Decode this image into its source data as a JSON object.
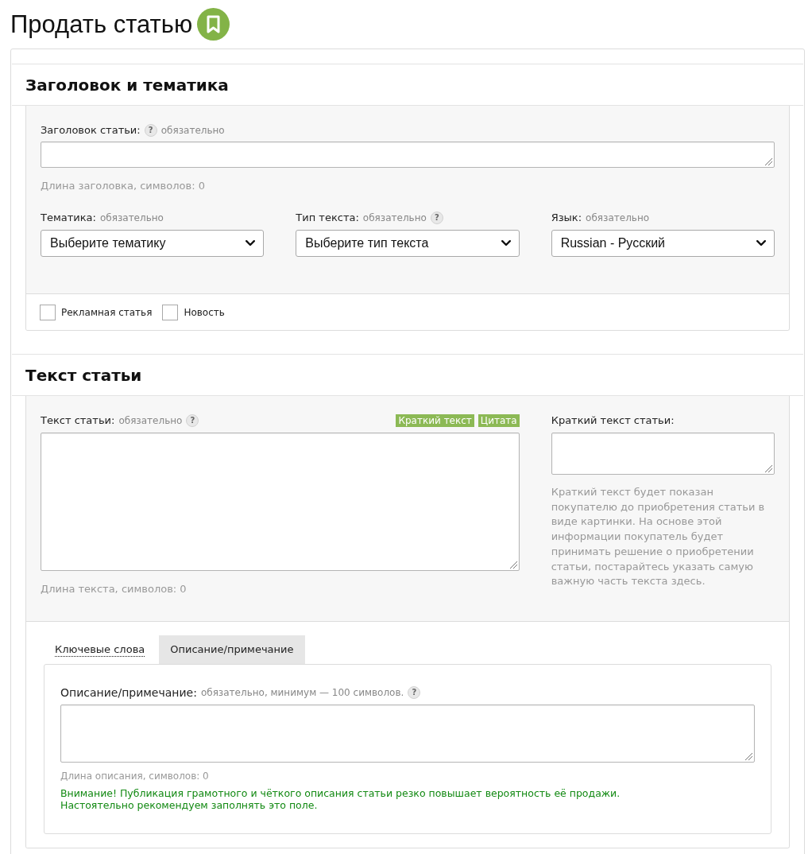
{
  "page_title": "Продать статью",
  "title_section": {
    "heading": "Заголовок и тематика",
    "title_field": {
      "label_parts": [
        {
          "kind": "label",
          "text": "Заголовок статьи:"
        },
        {
          "kind": "help",
          "text": "?"
        },
        {
          "kind": "note",
          "text": "обязательно"
        }
      ],
      "counter": "Длина заголовка, символов: 0"
    },
    "selects": [
      {
        "label_parts": [
          {
            "kind": "label",
            "text": "Тематика:"
          },
          {
            "kind": "note",
            "text": "обязательно"
          }
        ],
        "value": "Выберите тематику"
      },
      {
        "label_parts": [
          {
            "kind": "label",
            "text": "Тип текста:"
          },
          {
            "kind": "note",
            "text": "обязательно"
          },
          {
            "kind": "help",
            "text": "?"
          }
        ],
        "value": "Выберите тип текста"
      },
      {
        "label_parts": [
          {
            "kind": "label",
            "text": "Язык:"
          },
          {
            "kind": "note",
            "text": "обязательно"
          }
        ],
        "value": "Russian - Русский"
      }
    ],
    "checkboxes": [
      {
        "label": "Рекламная статья",
        "checked": false
      },
      {
        "label": "Новость",
        "checked": false
      }
    ]
  },
  "text_section": {
    "heading": "Текст статьи",
    "text_field": {
      "label_parts": [
        {
          "kind": "label",
          "text": "Текст статьи:"
        },
        {
          "kind": "note",
          "text": "обязательно"
        },
        {
          "kind": "help",
          "text": "?"
        }
      ],
      "tools": [
        "Краткий текст",
        "Цитата"
      ],
      "counter": "Длина текста, символов: 0"
    },
    "summary_field": {
      "label_parts": [
        {
          "kind": "label",
          "text": "Краткий текст статьи:"
        }
      ],
      "hint": "Краткий текст будет показан покупателю до приобретения статьи в виде картинки. На основе этой информации покупатель будет принимать решение о приобретении статьи, постарайтесь указать самую важную часть текста здесь."
    },
    "tabs": [
      {
        "label": "Ключевые слова",
        "selected": false
      },
      {
        "label": "Описание/примечание",
        "selected": true
      }
    ],
    "description_field": {
      "label_parts": [
        {
          "kind": "label",
          "text": "Описание/примечание:"
        },
        {
          "kind": "note",
          "text": "обязательно, минимум — 100 символов."
        },
        {
          "kind": "help",
          "text": "?"
        }
      ],
      "counter": "Длина описания, символов: 0",
      "warning": [
        "Внимание! Публикация грамотного и чёткого описания статьи резко повышает вероятность её продажи.",
        "Настоятельно рекомендуем заполнять это поле."
      ]
    }
  }
}
